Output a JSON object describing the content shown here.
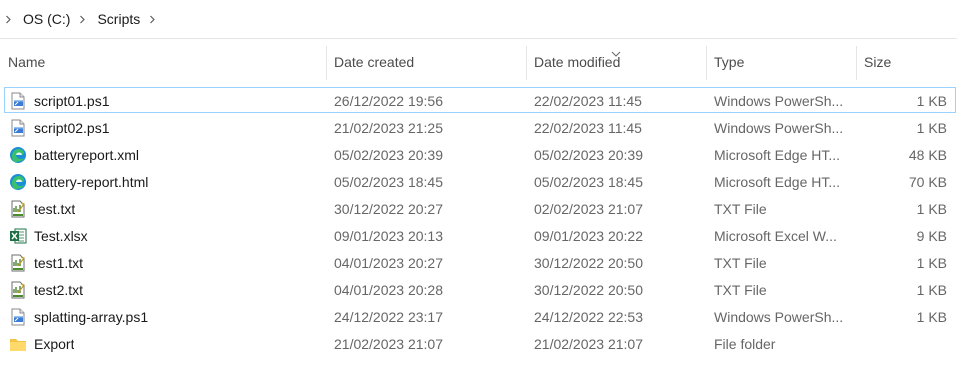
{
  "breadcrumb": [
    "OS (C:)",
    "Scripts"
  ],
  "columns": {
    "name": "Name",
    "created": "Date created",
    "modified": "Date modified",
    "type": "Type",
    "size": "Size"
  },
  "sorted_by": "Date modified",
  "files": [
    {
      "name": "script01.ps1",
      "created": "26/12/2022 19:56",
      "modified": "22/02/2023 11:45",
      "type": "Windows PowerSh...",
      "size": "1 KB",
      "icon": "powershell-script-icon",
      "selected": true
    },
    {
      "name": "script02.ps1",
      "created": "21/02/2023 21:25",
      "modified": "22/02/2023 11:45",
      "type": "Windows PowerSh...",
      "size": "1 KB",
      "icon": "powershell-script-icon",
      "selected": false
    },
    {
      "name": "batteryreport.xml",
      "created": "05/02/2023 20:39",
      "modified": "05/02/2023 20:39",
      "type": "Microsoft Edge HT...",
      "size": "48 KB",
      "icon": "edge-icon",
      "selected": false
    },
    {
      "name": "battery-report.html",
      "created": "05/02/2023 18:45",
      "modified": "05/02/2023 18:45",
      "type": "Microsoft Edge HT...",
      "size": "70 KB",
      "icon": "edge-icon",
      "selected": false
    },
    {
      "name": "test.txt",
      "created": "30/12/2022 20:27",
      "modified": "02/02/2023 21:07",
      "type": "TXT File",
      "size": "1 KB",
      "icon": "text-file-icon",
      "selected": false
    },
    {
      "name": "Test.xlsx",
      "created": "09/01/2023 20:13",
      "modified": "09/01/2023 20:22",
      "type": "Microsoft Excel W...",
      "size": "9 KB",
      "icon": "excel-icon",
      "selected": false
    },
    {
      "name": "test1.txt",
      "created": "04/01/2023 20:27",
      "modified": "30/12/2022 20:50",
      "type": "TXT File",
      "size": "1 KB",
      "icon": "text-file-icon",
      "selected": false
    },
    {
      "name": "test2.txt",
      "created": "04/01/2023 20:28",
      "modified": "30/12/2022 20:50",
      "type": "TXT File",
      "size": "1 KB",
      "icon": "text-file-icon",
      "selected": false
    },
    {
      "name": "splatting-array.ps1",
      "created": "24/12/2022 23:17",
      "modified": "24/12/2022 22:53",
      "type": "Windows PowerSh...",
      "size": "1 KB",
      "icon": "powershell-script-icon",
      "selected": false
    },
    {
      "name": "Export",
      "created": "21/02/2023 21:07",
      "modified": "21/02/2023 21:07",
      "type": "File folder",
      "size": "",
      "icon": "folder-icon",
      "selected": false
    }
  ]
}
